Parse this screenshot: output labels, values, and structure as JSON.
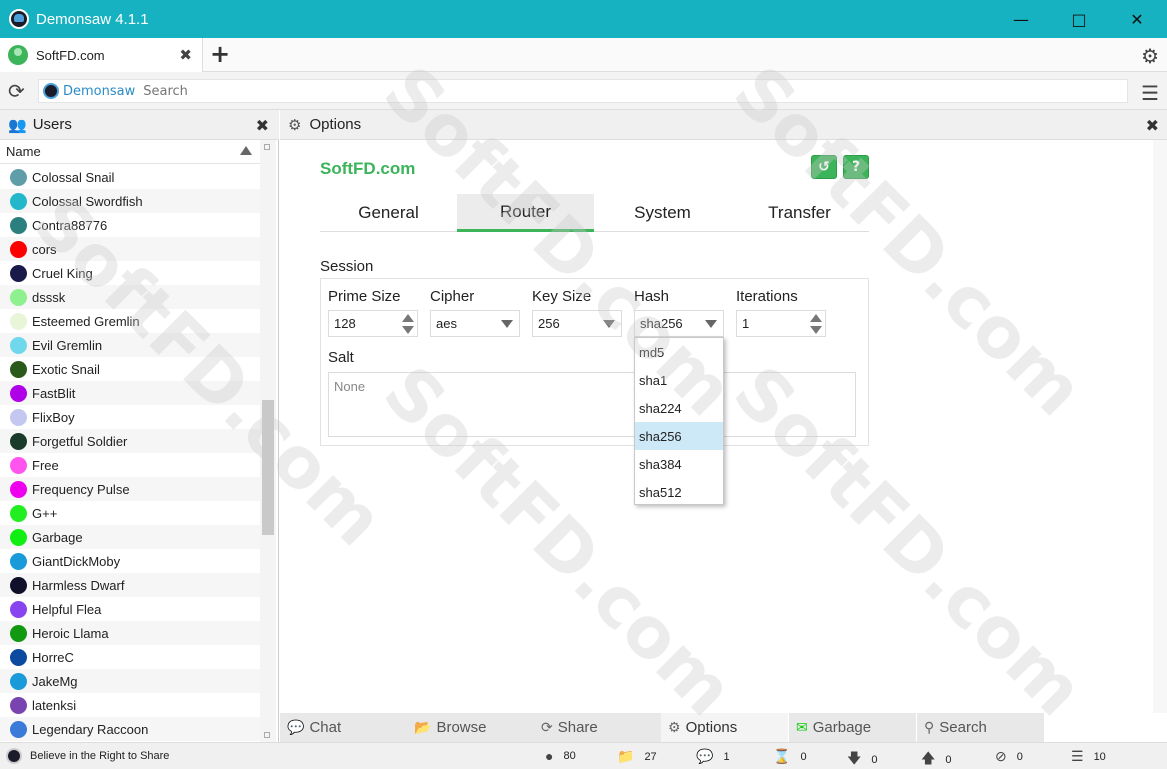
{
  "window": {
    "title": "Demonsaw 4.1.1"
  },
  "tabs": {
    "active_label": "SoftFD.com"
  },
  "address": {
    "crumb": "Demonsaw",
    "search_placeholder": "Search"
  },
  "users": {
    "title": "Users",
    "column": "Name",
    "list": [
      {
        "name": "Colossal Snail",
        "color": "#5f9ea8"
      },
      {
        "name": "Colossal Swordfish",
        "color": "#22b8c9"
      },
      {
        "name": "Contra88776",
        "color": "#2b7f7f"
      },
      {
        "name": "cors",
        "color": "#ff0000"
      },
      {
        "name": "Cruel King",
        "color": "#1a1a4a"
      },
      {
        "name": "dsssk",
        "color": "#8ff08f"
      },
      {
        "name": "Esteemed Gremlin",
        "color": "#e8f5d8"
      },
      {
        "name": "Evil Gremlin",
        "color": "#6fd8ec"
      },
      {
        "name": "Exotic Snail",
        "color": "#2a5a1a"
      },
      {
        "name": "FastBlit",
        "color": "#b000e8"
      },
      {
        "name": "FlixBoy",
        "color": "#c4c8f0"
      },
      {
        "name": "Forgetful Soldier",
        "color": "#1a3a2a"
      },
      {
        "name": "Free",
        "color": "#ff55ee"
      },
      {
        "name": "Frequency Pulse",
        "color": "#ee00ee"
      },
      {
        "name": "G++",
        "color": "#22ee22"
      },
      {
        "name": "Garbage",
        "color": "#11ee11"
      },
      {
        "name": "GiantDickMoby",
        "color": "#1a9ad8"
      },
      {
        "name": "Harmless Dwarf",
        "color": "#10102a"
      },
      {
        "name": "Helpful Flea",
        "color": "#8844ee"
      },
      {
        "name": "Heroic Llama",
        "color": "#119911"
      },
      {
        "name": "HorreC",
        "color": "#0c4aa0"
      },
      {
        "name": "JakeMg",
        "color": "#1a9ad8"
      },
      {
        "name": "latenksi",
        "color": "#7a44b0"
      },
      {
        "name": "Legendary Raccoon",
        "color": "#3a7ad8"
      }
    ]
  },
  "options": {
    "title": "Options",
    "brand": "SoftFD.com",
    "tabs": [
      "General",
      "Router",
      "System",
      "Transfer"
    ],
    "session_label": "Session",
    "fields": {
      "prime_size": {
        "label": "Prime Size",
        "value": "128"
      },
      "cipher": {
        "label": "Cipher",
        "value": "aes"
      },
      "key_size": {
        "label": "Key Size",
        "value": "256"
      },
      "hash": {
        "label": "Hash",
        "value": "sha256"
      },
      "iterations": {
        "label": "Iterations",
        "value": "1"
      }
    },
    "salt": {
      "label": "Salt",
      "placeholder": "None"
    },
    "hash_options": [
      "md5",
      "sha1",
      "sha224",
      "sha256",
      "sha384",
      "sha512"
    ],
    "hash_selected": "sha256"
  },
  "bottom_tabs": [
    "Chat",
    "Browse",
    "Share",
    "Options",
    "Garbage",
    "Search"
  ],
  "status": {
    "motto": "Believe in the Right to Share",
    "users": "80",
    "folders": "27",
    "chats": "1",
    "pending": "0",
    "downloads": "0",
    "uploads": "0",
    "errors": "0",
    "routers": "10"
  },
  "watermark": "SoftFD.com",
  "colors": {
    "titlebar": "#17b2c1",
    "accent": "#3cb45a",
    "link": "#2a8cc4"
  }
}
